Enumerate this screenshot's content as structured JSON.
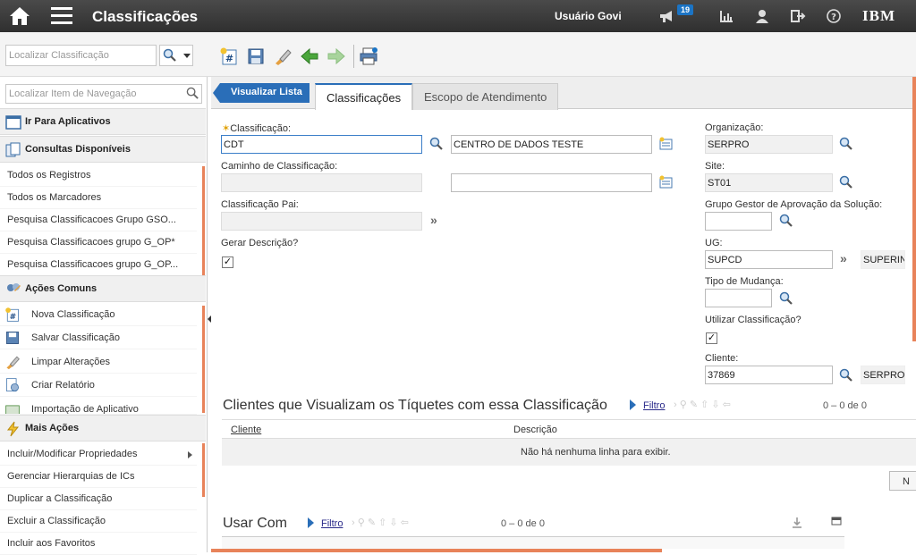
{
  "topbar": {
    "title": "Classificações",
    "user": "Usuário Govi",
    "notifications": "19",
    "brand": "IBM"
  },
  "toolbar": {
    "search_placeholder": "Localizar Classificação"
  },
  "nav": {
    "search_placeholder": "Localizar Item de Navegação",
    "go_to_apps": "Ir Para Aplicativos",
    "queries_header": "Consultas Disponíveis",
    "queries": [
      "Todos os Registros",
      "Todos os Marcadores",
      "Pesquisa Classificacoes Grupo GSO...",
      "Pesquisa Classificacoes grupo G_OP*",
      "Pesquisa Classificacoes grupo G_OP..."
    ],
    "common_header": "Ações Comuns",
    "common": [
      "Nova Classificação",
      "Salvar Classificação",
      "Limpar Alterações",
      "Criar Relatório",
      "Importação de Aplicativo"
    ],
    "more_header": "Mais Ações",
    "more": [
      "Incluir/Modificar Propriedades",
      "Gerenciar Hierarquias de ICs",
      "Duplicar a Classificação",
      "Excluir a Classificação",
      "Incluir aos Favoritos"
    ]
  },
  "tabs": {
    "back": "Visualizar Lista",
    "active": "Classificações",
    "other": "Escopo de Atendimento"
  },
  "form": {
    "classificacao_label": "Classificação:",
    "classificacao_value": "CDT",
    "descricao_value": "CENTRO DE DADOS TESTE",
    "caminho_label": "Caminho de Classificação:",
    "pai_label": "Classificação Pai:",
    "gerar_label": "Gerar Descrição?",
    "org_label": "Organização:",
    "org_value": "SERPRO",
    "site_label": "Site:",
    "site_value": "ST01",
    "grupo_label": "Grupo Gestor de Aprovação da Solução:",
    "ug_label": "UG:",
    "ug_value": "SUPCD",
    "ug_desc": "SUPERINT",
    "tipo_label": "Tipo de Mudança:",
    "utilizar_label": "Utilizar Classificação?",
    "cliente_label": "Cliente:",
    "cliente_value": "37869",
    "cliente_desc": "SERPRO"
  },
  "clientes": {
    "title": "Clientes que Visualizam os Tíquetes com essa Classificação",
    "filter": "Filtro",
    "pager_from": "0",
    "pager_to": "0",
    "pager_of": "de",
    "pager_total": "0",
    "col1": "Cliente",
    "col2": "Descrição",
    "empty": "Não há nenhuma linha para exibir.",
    "new_btn": "N"
  },
  "usar": {
    "title": "Usar Com",
    "filter": "Filtro",
    "pager_from": "0",
    "pager_to": "0",
    "pager_of": "de",
    "pager_total": "0"
  }
}
